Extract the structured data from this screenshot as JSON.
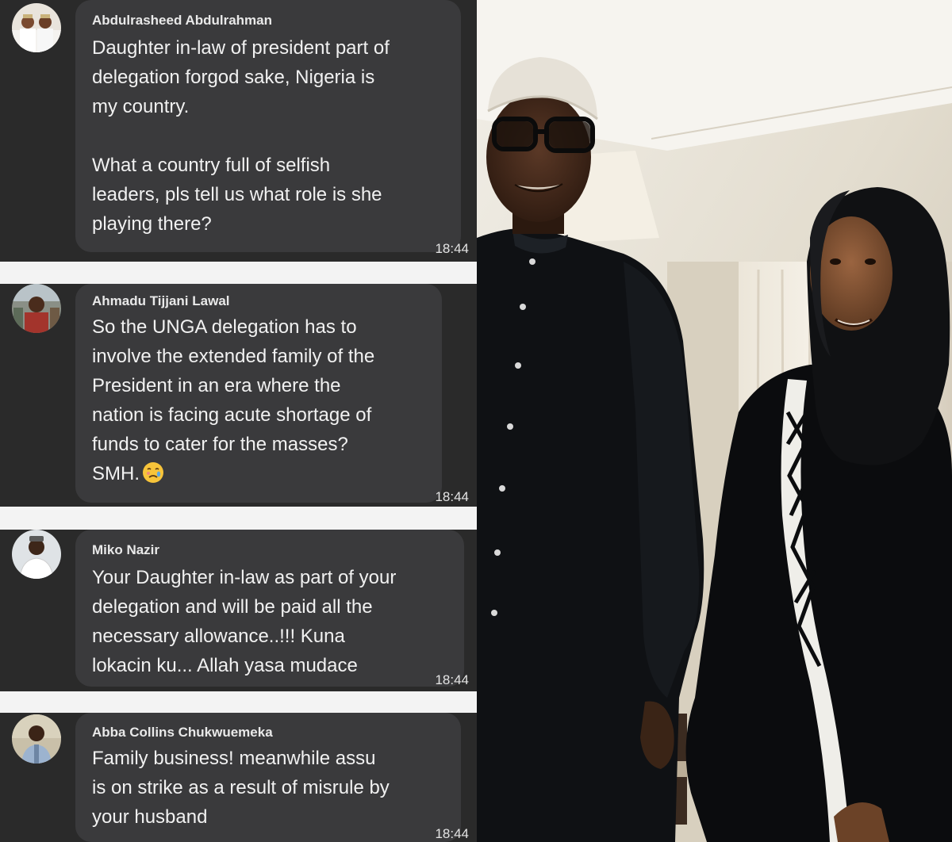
{
  "comments": [
    {
      "author": "Abdulrasheed Abdulrahman",
      "text": "Daughter in-law of president part of\ndelegation forgod sake, Nigeria is\nmy country.\n\nWhat a country full of selfish\nleaders, pls tell us what role is she\nplaying there?",
      "time": "18:44",
      "avatar_icon": "profile-photo"
    },
    {
      "author": "Ahmadu Tijjani Lawal",
      "text": "So the UNGA delegation has to\ninvolve the extended family of the\nPresident in an era where the\nnation is facing acute shortage of\nfunds to cater for the masses?\nSMH.",
      "emoji": "crying-face-emoji",
      "time": "18:44",
      "avatar_icon": "profile-photo"
    },
    {
      "author": "Miko Nazir",
      "text": "Your Daughter in-law as part of your\ndelegation and will be paid all the\nnecessary allowance..!!! Kuna\nlokacin ku... Allah yasa mudace",
      "time": "18:44",
      "avatar_icon": "profile-photo"
    },
    {
      "author": "Abba Collins Chukwuemeka",
      "text": "Family business! meanwhile assu\nis on strike as a result of misrule by\nyour husband",
      "time": "18:44",
      "avatar_icon": "profile-photo"
    }
  ],
  "photo": {
    "icon": "photo-of-two-people"
  },
  "colors": {
    "panel_bg": "#2a2a2a",
    "bubble_bg": "#3a3a3c",
    "separator": "#f3f3f3",
    "text": "#f1f1f1"
  }
}
